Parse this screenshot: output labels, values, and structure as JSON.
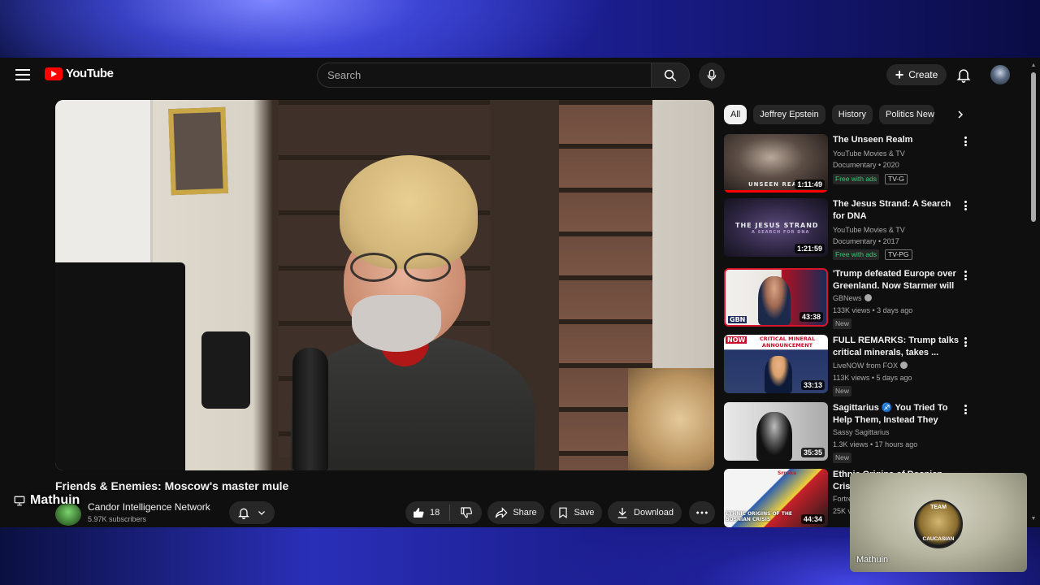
{
  "header": {
    "logo_text": "YouTube",
    "search_placeholder": "Search",
    "create_label": "Create"
  },
  "video": {
    "title": "Friends & Enemies: Moscow's master mule",
    "channel_name": "Candor Intelligence Network",
    "subscribers": "5.97K subscribers",
    "likes": "18",
    "share_label": "Share",
    "save_label": "Save",
    "download_label": "Download"
  },
  "overlay": {
    "presenter_name": "Mathuin"
  },
  "chips": [
    "All",
    "Jeffrey Epstein",
    "History",
    "Politics News"
  ],
  "recommendations": [
    {
      "title": "The Unseen Realm",
      "line1": "YouTube Movies & TV",
      "line2": "Documentary • 2020",
      "badge_free": "Free with ads",
      "badge_rating": "TV-G",
      "duration": "1:11:49",
      "thumb_text": "UNSEEN REALM"
    },
    {
      "title": "The Jesus Strand: A Search for DNA",
      "line1": "YouTube Movies & TV",
      "line2": "Documentary • 2017",
      "badge_free": "Free with ads",
      "badge_rating": "TV-PG",
      "duration": "1:21:59",
      "thumb_text": "THE JESUS STRAND",
      "thumb_subtext": "A SEARCH FOR DNA"
    },
    {
      "title": "'Trump defeated Europe over Greenland. Now Starmer will ...",
      "line1": "GBNews",
      "line2": "133K views • 3 days ago",
      "badge_new": "New",
      "duration": "43:38",
      "thumb_text": "GBN"
    },
    {
      "title": "FULL REMARKS: Trump talks critical minerals, takes ...",
      "line1": "LiveNOW from FOX",
      "line2": "113K views • 5 days ago",
      "badge_new": "New",
      "duration": "33:13",
      "thumb_text": "CRITICAL MINERAL ANNOUNCEMENT",
      "thumb_subtext": "NOW"
    },
    {
      "title": "Sagittarius ♐ You Tried To Help Them, Instead They Took...",
      "line1": "Sassy Sagittarius",
      "line2": "1.3K views • 17 hours ago",
      "badge_new": "New",
      "duration": "35:35"
    },
    {
      "title": "Ethnic Origins of Bosnian Crisis",
      "line1": "Fortress",
      "line2": "25K views",
      "duration": "44:34",
      "thumb_text": "ETHNIC ORIGINS OF THE BOSNIAN CRISIS",
      "thumb_subtext": "Srpska"
    }
  ],
  "webcam": {
    "name": "Mathuin",
    "badge_top": "TEAM",
    "badge_bottom": "CAUCASIAN"
  },
  "colors": {
    "brand_red": "#ff0000",
    "background": "#0f0f0f",
    "free_green": "#2ecc71"
  }
}
